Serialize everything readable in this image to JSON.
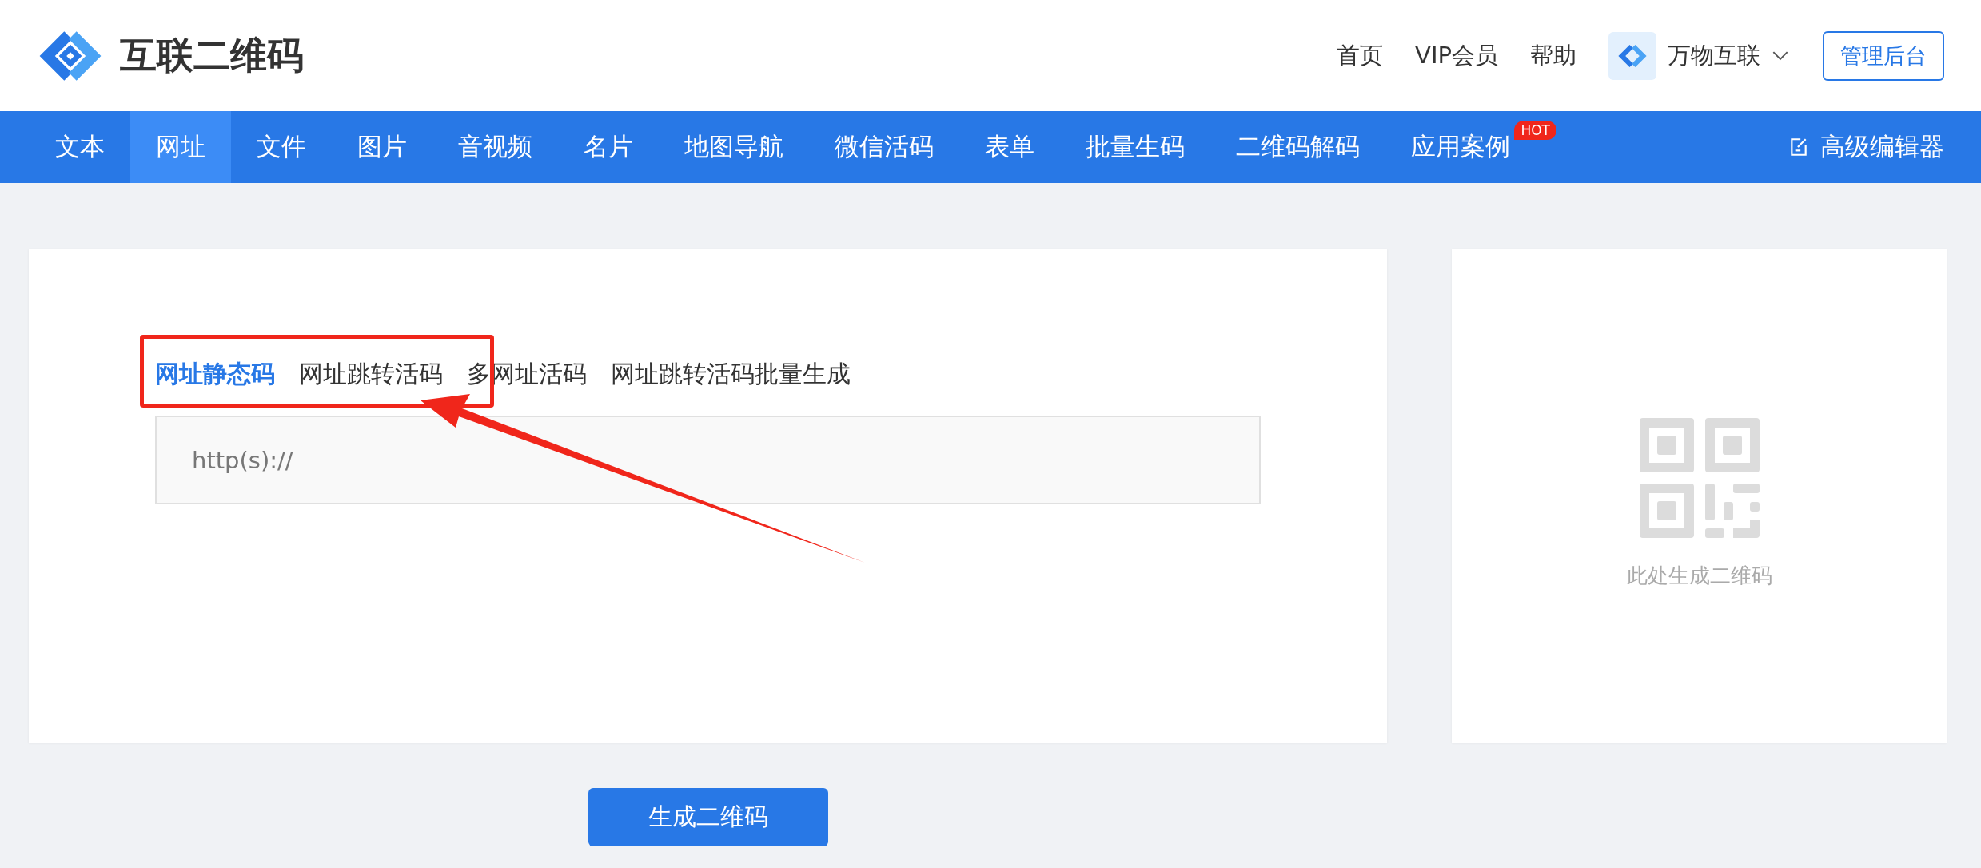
{
  "header": {
    "logo_text": "互联二维码",
    "links": [
      "首页",
      "VIP会员",
      "帮助"
    ],
    "account": {
      "name": "万物互联"
    },
    "admin_button": "管理后台"
  },
  "nav": {
    "items": [
      {
        "label": "文本",
        "selected": false
      },
      {
        "label": "网址",
        "selected": true
      },
      {
        "label": "文件",
        "selected": false
      },
      {
        "label": "图片",
        "selected": false
      },
      {
        "label": "音视频",
        "selected": false
      },
      {
        "label": "名片",
        "selected": false
      },
      {
        "label": "地图导航",
        "selected": false
      },
      {
        "label": "微信活码",
        "selected": false
      },
      {
        "label": "表单",
        "selected": false
      },
      {
        "label": "批量生码",
        "selected": false
      },
      {
        "label": "二维码解码",
        "selected": false
      },
      {
        "label": "应用案例",
        "selected": false,
        "badge": "HOT"
      }
    ],
    "editor_link": "高级编辑器"
  },
  "tabs": [
    {
      "label": "网址静态码",
      "selected": true
    },
    {
      "label": "网址跳转活码",
      "selected": false
    },
    {
      "label": "多网址活码",
      "selected": false
    },
    {
      "label": "网址跳转活码批量生成",
      "selected": false
    }
  ],
  "url_input": {
    "placeholder": "http(s)://"
  },
  "generate_button": "生成二维码",
  "preview": {
    "caption": "此处生成二维码"
  }
}
